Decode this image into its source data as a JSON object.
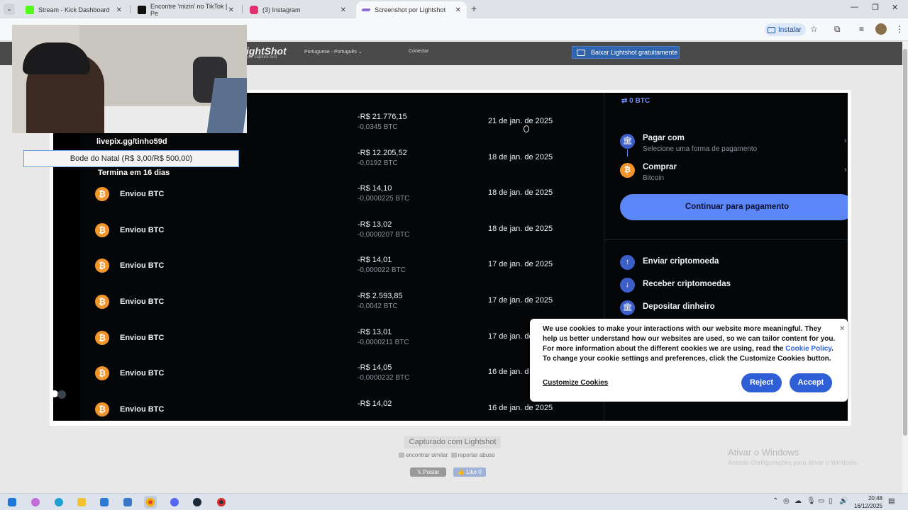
{
  "browser": {
    "tabs": [
      {
        "title": "Stream - Kick Dashboard",
        "color": "#53fc18"
      },
      {
        "title": "Encontre 'mizin' no TikTok | Pe",
        "color": "#111111"
      },
      {
        "title": "(3) Instagram",
        "color": "#e1306c"
      },
      {
        "title": "Screenshot por Lightshot",
        "color": "#8e6bd8"
      }
    ],
    "install_label": "Instalar"
  },
  "lightshot": {
    "logo": "ightShot",
    "tagline": "een capture tool",
    "language": "Portuguese - Português",
    "connect": "Conectar",
    "download_label": "Baixar Lightshot gratuitamente",
    "captured": "Capturado com Lightshot",
    "similar": "encontrar similar",
    "report": "reportar abuso",
    "post": "Postar",
    "like": "Like 0"
  },
  "transactions": [
    {
      "label": "",
      "amount": "-R$ 21.776,15",
      "btc": "-0,0345 BTC",
      "date": "21 de jan. de 2025",
      "show_coin": false
    },
    {
      "label": "",
      "amount": "-R$ 12.205,52",
      "btc": "-0,0192 BTC",
      "date": "18 de jan. de 2025",
      "show_coin": false
    },
    {
      "label": "Enviou BTC",
      "amount": "-R$ 14,10",
      "btc": "-0,0000225 BTC",
      "date": "18 de jan. de 2025",
      "show_coin": true
    },
    {
      "label": "Enviou BTC",
      "amount": "-R$ 13,02",
      "btc": "-0,0000207 BTC",
      "date": "18 de jan. de 2025",
      "show_coin": true
    },
    {
      "label": "Enviou BTC",
      "amount": "-R$ 14,01",
      "btc": "-0,000022 BTC",
      "date": "17 de jan. de 2025",
      "show_coin": true
    },
    {
      "label": "Enviou BTC",
      "amount": "-R$ 2.593,85",
      "btc": "-0,0042 BTC",
      "date": "17 de jan. de 2025",
      "show_coin": true
    },
    {
      "label": "Enviou BTC",
      "amount": "-R$ 13,01",
      "btc": "-0,0000211 BTC",
      "date": "17 de jan. de",
      "show_coin": true
    },
    {
      "label": "Enviou BTC",
      "amount": "-R$ 14,05",
      "btc": "-0,0000232 BTC",
      "date": "16 de jan. d",
      "show_coin": true
    },
    {
      "label": "Enviou BTC",
      "amount": "-R$ 14,02",
      "btc": "",
      "date": "16 de jan. de 2025",
      "show_coin": true
    }
  ],
  "panel": {
    "balance": "0 BTC",
    "pay_title": "Pagar com",
    "pay_sub": "Selecione uma forma de pagamento",
    "buy_title": "Comprar",
    "buy_sub": "Bitcoin",
    "cta": "Continuar para pagamento",
    "actions": [
      "Enviar criptomoeda",
      "Receber criptomoedas",
      "Depositar dinheiro"
    ]
  },
  "cookie": {
    "text_a": "We use cookies to make your interactions with our website more meaningful. They help us better understand how our websites are used, so we can tailor content for you. For more information about the different cookies we are using, read the",
    "link": "Cookie Policy",
    "text_b": ". To change your cookie settings and preferences, click the Customize Cookies button.",
    "customize": "Customize Cookies",
    "reject": "Reject",
    "accept": "Accept"
  },
  "stream_overlay": {
    "livepix": "livepix.gg/tinho59d",
    "goal": "Bode do Natal (R$ 3,00/R$ 500,00)",
    "ends": "Termina em 16 dias"
  },
  "windows": {
    "activate_title": "Ativar o Windows",
    "activate_sub": "Acesse Configurações para ativar o Windows.",
    "time": "20:48",
    "date": "16/12/2025"
  },
  "colors": {
    "accent": "#5b86f7",
    "btc": "#f2962b",
    "bg": "#050608"
  }
}
